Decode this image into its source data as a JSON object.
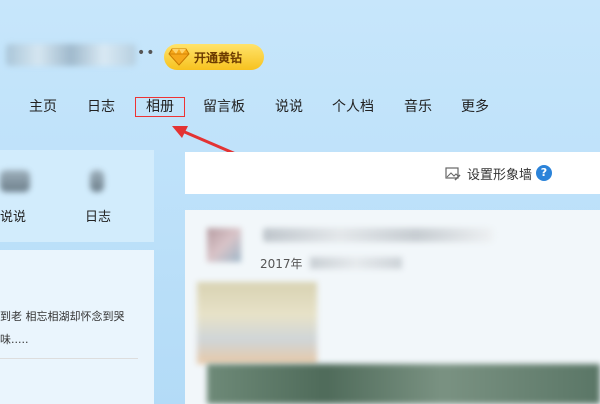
{
  "header": {
    "vip_label": "开通黄钻",
    "dots": "••"
  },
  "nav": {
    "items": [
      "主页",
      "日志",
      "相册",
      "留言板",
      "说说",
      "个人档",
      "音乐",
      "更多"
    ],
    "active_index": 2
  },
  "left_panel": {
    "apps": [
      "说说",
      "日志"
    ],
    "feed_text_1": "到老 相忘相湖却怀念到哭",
    "feed_text_2": "味....."
  },
  "right_panel": {
    "photo_wall_label": "设置形象墙",
    "help_glyph": "?",
    "post_date": "2017年"
  },
  "colors": {
    "accent_red": "#e33333",
    "help_blue": "#2b83d9",
    "vip_gold": "#f7c21f"
  }
}
